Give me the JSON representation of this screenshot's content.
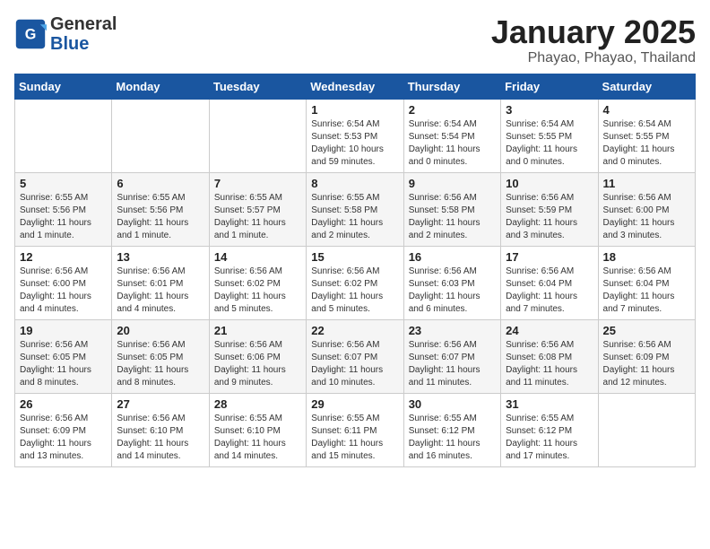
{
  "logo": {
    "line1": "General",
    "line2": "Blue"
  },
  "title": "January 2025",
  "subtitle": "Phayao, Phayao, Thailand",
  "weekdays": [
    "Sunday",
    "Monday",
    "Tuesday",
    "Wednesday",
    "Thursday",
    "Friday",
    "Saturday"
  ],
  "weeks": [
    [
      {
        "day": "",
        "info": ""
      },
      {
        "day": "",
        "info": ""
      },
      {
        "day": "",
        "info": ""
      },
      {
        "day": "1",
        "info": "Sunrise: 6:54 AM\nSunset: 5:53 PM\nDaylight: 10 hours\nand 59 minutes."
      },
      {
        "day": "2",
        "info": "Sunrise: 6:54 AM\nSunset: 5:54 PM\nDaylight: 11 hours\nand 0 minutes."
      },
      {
        "day": "3",
        "info": "Sunrise: 6:54 AM\nSunset: 5:55 PM\nDaylight: 11 hours\nand 0 minutes."
      },
      {
        "day": "4",
        "info": "Sunrise: 6:54 AM\nSunset: 5:55 PM\nDaylight: 11 hours\nand 0 minutes."
      }
    ],
    [
      {
        "day": "5",
        "info": "Sunrise: 6:55 AM\nSunset: 5:56 PM\nDaylight: 11 hours\nand 1 minute."
      },
      {
        "day": "6",
        "info": "Sunrise: 6:55 AM\nSunset: 5:56 PM\nDaylight: 11 hours\nand 1 minute."
      },
      {
        "day": "7",
        "info": "Sunrise: 6:55 AM\nSunset: 5:57 PM\nDaylight: 11 hours\nand 1 minute."
      },
      {
        "day": "8",
        "info": "Sunrise: 6:55 AM\nSunset: 5:58 PM\nDaylight: 11 hours\nand 2 minutes."
      },
      {
        "day": "9",
        "info": "Sunrise: 6:56 AM\nSunset: 5:58 PM\nDaylight: 11 hours\nand 2 minutes."
      },
      {
        "day": "10",
        "info": "Sunrise: 6:56 AM\nSunset: 5:59 PM\nDaylight: 11 hours\nand 3 minutes."
      },
      {
        "day": "11",
        "info": "Sunrise: 6:56 AM\nSunset: 6:00 PM\nDaylight: 11 hours\nand 3 minutes."
      }
    ],
    [
      {
        "day": "12",
        "info": "Sunrise: 6:56 AM\nSunset: 6:00 PM\nDaylight: 11 hours\nand 4 minutes."
      },
      {
        "day": "13",
        "info": "Sunrise: 6:56 AM\nSunset: 6:01 PM\nDaylight: 11 hours\nand 4 minutes."
      },
      {
        "day": "14",
        "info": "Sunrise: 6:56 AM\nSunset: 6:02 PM\nDaylight: 11 hours\nand 5 minutes."
      },
      {
        "day": "15",
        "info": "Sunrise: 6:56 AM\nSunset: 6:02 PM\nDaylight: 11 hours\nand 5 minutes."
      },
      {
        "day": "16",
        "info": "Sunrise: 6:56 AM\nSunset: 6:03 PM\nDaylight: 11 hours\nand 6 minutes."
      },
      {
        "day": "17",
        "info": "Sunrise: 6:56 AM\nSunset: 6:04 PM\nDaylight: 11 hours\nand 7 minutes."
      },
      {
        "day": "18",
        "info": "Sunrise: 6:56 AM\nSunset: 6:04 PM\nDaylight: 11 hours\nand 7 minutes."
      }
    ],
    [
      {
        "day": "19",
        "info": "Sunrise: 6:56 AM\nSunset: 6:05 PM\nDaylight: 11 hours\nand 8 minutes."
      },
      {
        "day": "20",
        "info": "Sunrise: 6:56 AM\nSunset: 6:05 PM\nDaylight: 11 hours\nand 8 minutes."
      },
      {
        "day": "21",
        "info": "Sunrise: 6:56 AM\nSunset: 6:06 PM\nDaylight: 11 hours\nand 9 minutes."
      },
      {
        "day": "22",
        "info": "Sunrise: 6:56 AM\nSunset: 6:07 PM\nDaylight: 11 hours\nand 10 minutes."
      },
      {
        "day": "23",
        "info": "Sunrise: 6:56 AM\nSunset: 6:07 PM\nDaylight: 11 hours\nand 11 minutes."
      },
      {
        "day": "24",
        "info": "Sunrise: 6:56 AM\nSunset: 6:08 PM\nDaylight: 11 hours\nand 11 minutes."
      },
      {
        "day": "25",
        "info": "Sunrise: 6:56 AM\nSunset: 6:09 PM\nDaylight: 11 hours\nand 12 minutes."
      }
    ],
    [
      {
        "day": "26",
        "info": "Sunrise: 6:56 AM\nSunset: 6:09 PM\nDaylight: 11 hours\nand 13 minutes."
      },
      {
        "day": "27",
        "info": "Sunrise: 6:56 AM\nSunset: 6:10 PM\nDaylight: 11 hours\nand 14 minutes."
      },
      {
        "day": "28",
        "info": "Sunrise: 6:55 AM\nSunset: 6:10 PM\nDaylight: 11 hours\nand 14 minutes."
      },
      {
        "day": "29",
        "info": "Sunrise: 6:55 AM\nSunset: 6:11 PM\nDaylight: 11 hours\nand 15 minutes."
      },
      {
        "day": "30",
        "info": "Sunrise: 6:55 AM\nSunset: 6:12 PM\nDaylight: 11 hours\nand 16 minutes."
      },
      {
        "day": "31",
        "info": "Sunrise: 6:55 AM\nSunset: 6:12 PM\nDaylight: 11 hours\nand 17 minutes."
      },
      {
        "day": "",
        "info": ""
      }
    ]
  ]
}
